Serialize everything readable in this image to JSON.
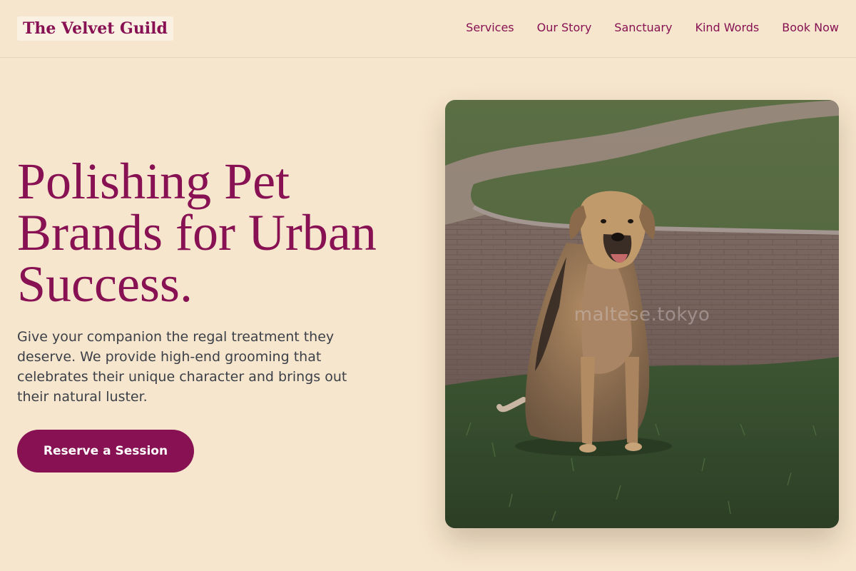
{
  "header": {
    "logo": "The Velvet Guild",
    "nav": [
      "Services",
      "Our Story",
      "Sanctuary",
      "Kind Words",
      "Book Now"
    ]
  },
  "hero": {
    "headline": "Polishing Pet Brands for Urban Success.",
    "description": "Give your companion the regal treatment they deserve. We provide high-end grooming that celebrates their unique character and brings out their natural luster.",
    "cta_label": "Reserve a Session",
    "image_watermark": "maltese.tokyo"
  },
  "colors": {
    "background": "#f6e6cd",
    "accent": "#871152",
    "body_text": "#3b3f47"
  }
}
